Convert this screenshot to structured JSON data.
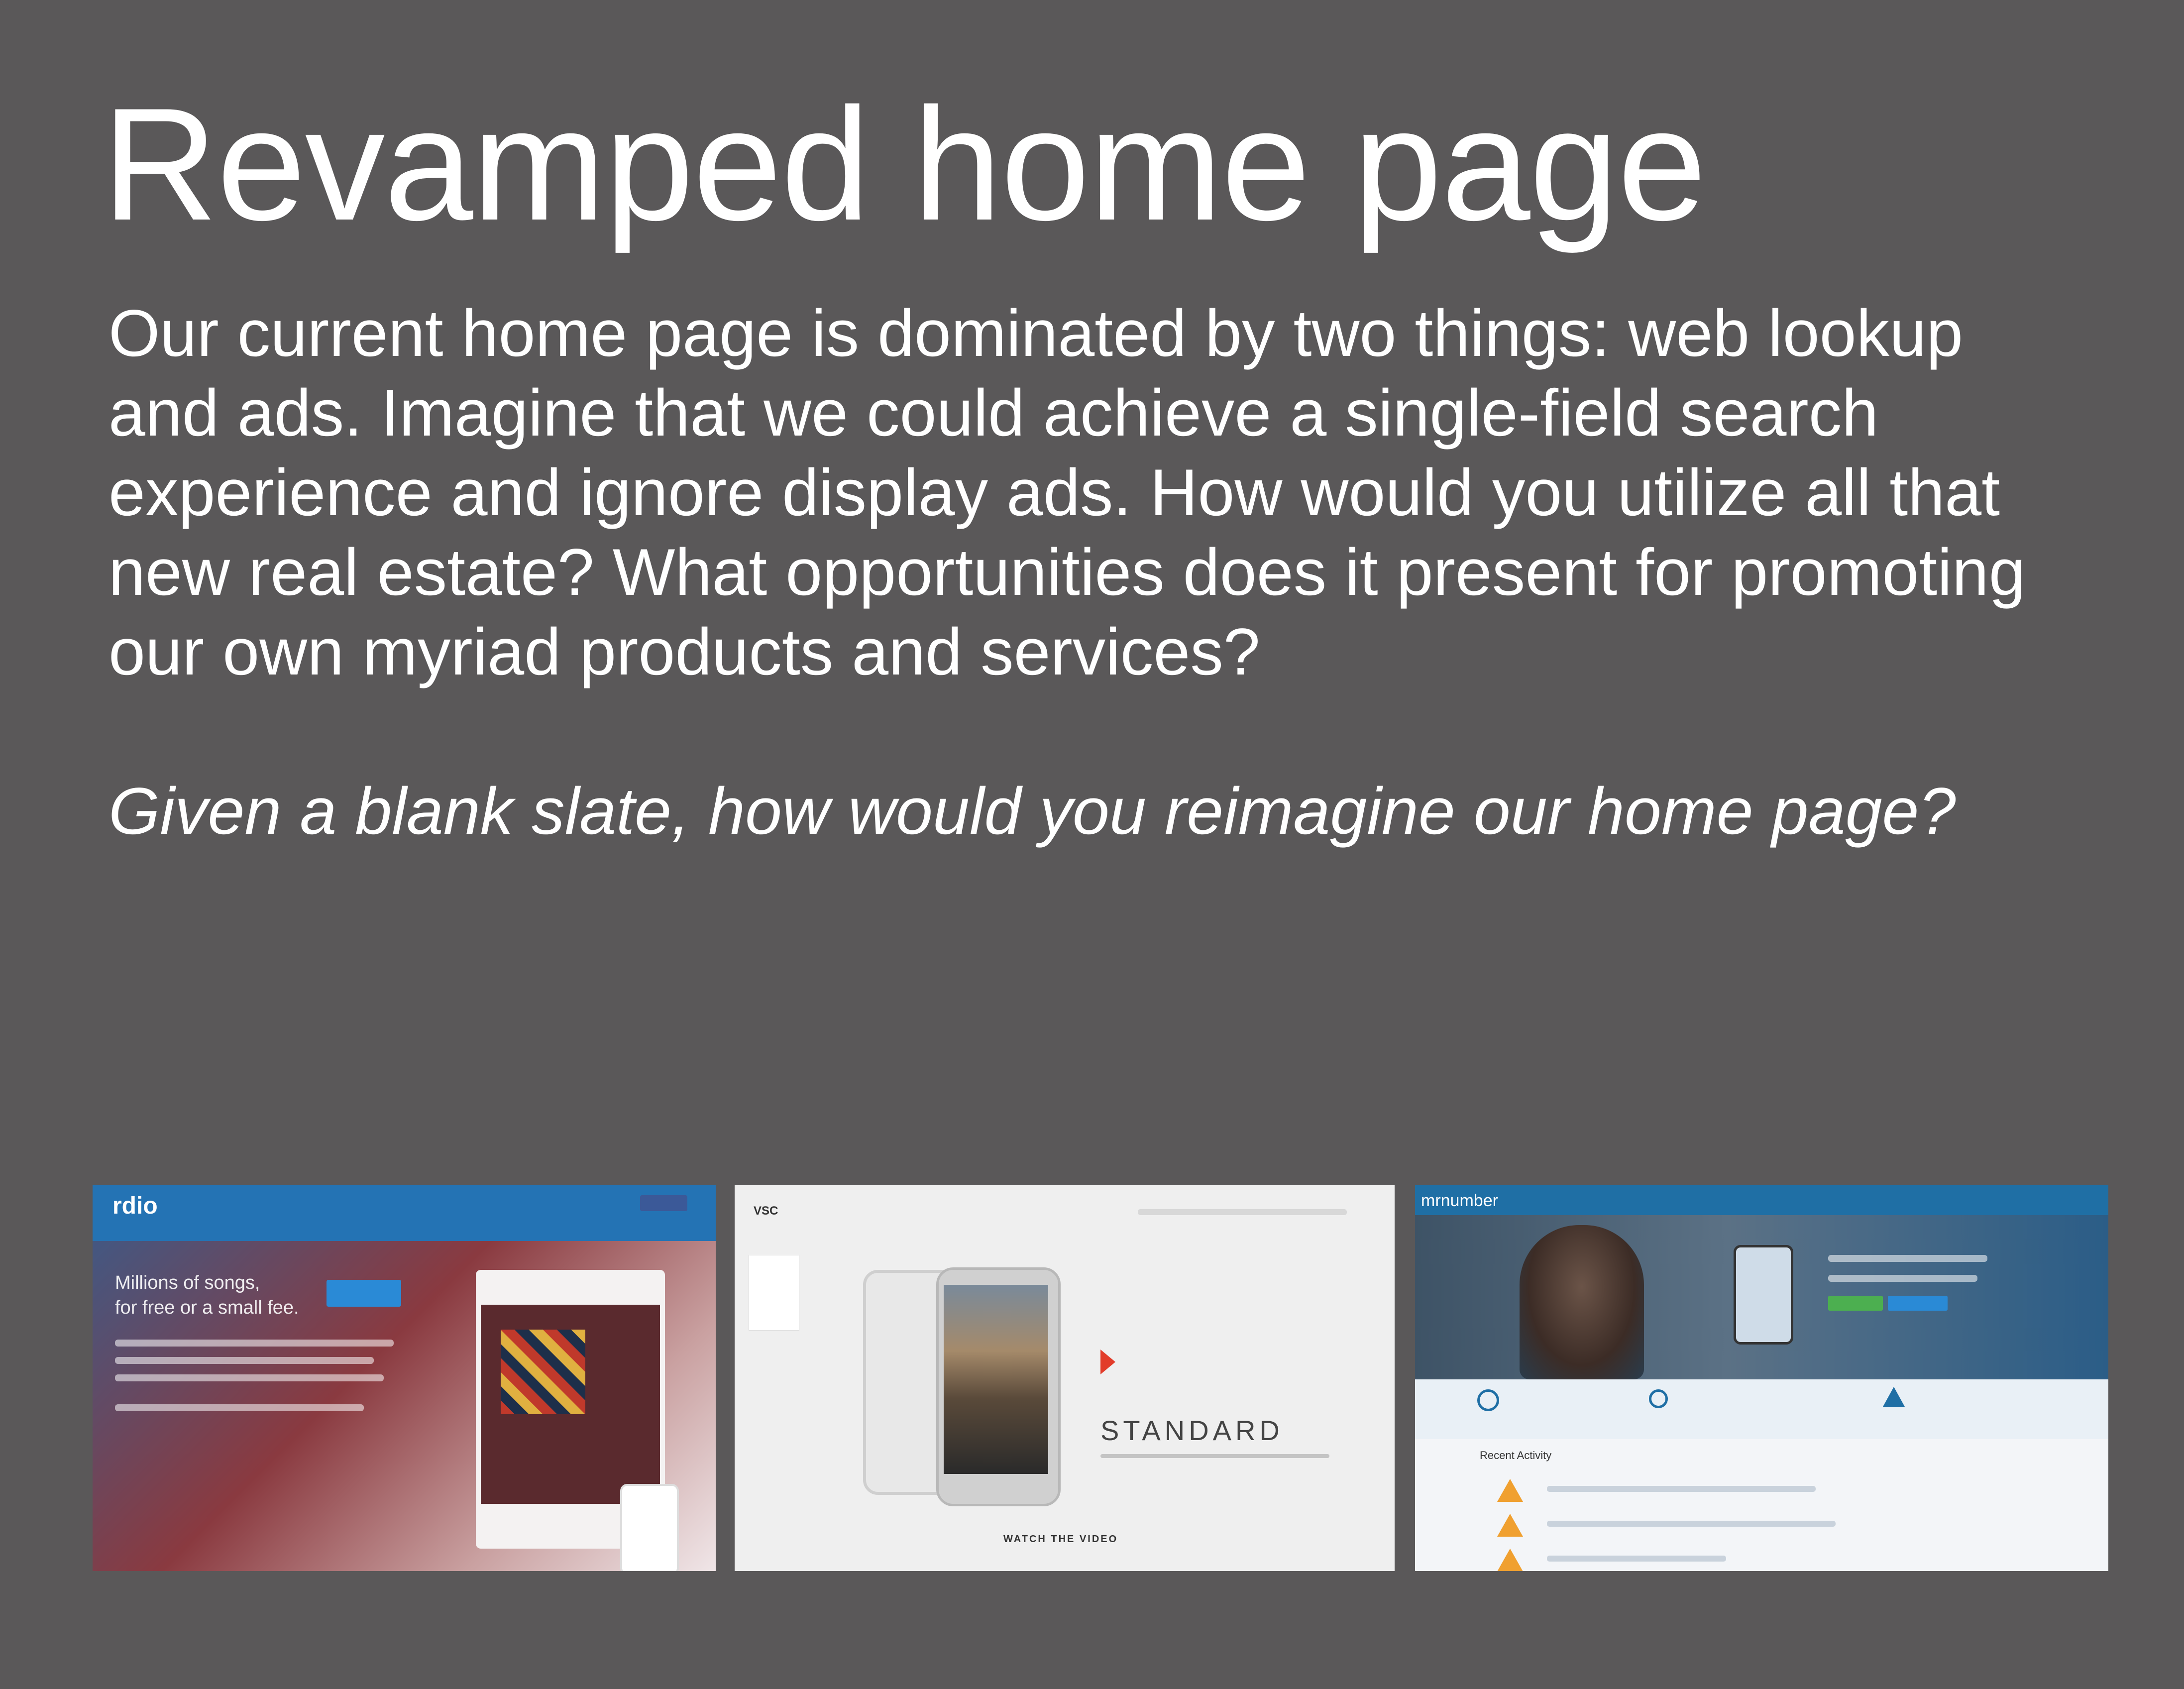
{
  "slide": {
    "title": "Revamped home page",
    "body_lines": [
      "Our current home page is dominated by two things: web lookup",
      "and ads. Imagine that we could achieve a single-field search",
      "experience and ignore display ads. How would you utilize all that",
      "new real estate? What opportunities does it present for promoting",
      "our own myriad products and services?"
    ],
    "question": "Given a blank slate, how would you reimagine our home page?"
  },
  "thumbnails": [
    {
      "logo": "rdio",
      "headline_line1": "Millions of songs,",
      "headline_line2": "for free or a small fee."
    },
    {
      "logo": "VSC",
      "brand": "STANDARD",
      "cta": "WATCH THE VIDEO"
    },
    {
      "logo": "mrnumber",
      "section_heading": "Recent Activity"
    }
  ],
  "colors": {
    "background": "#5a5859",
    "text": "#ffffff"
  }
}
